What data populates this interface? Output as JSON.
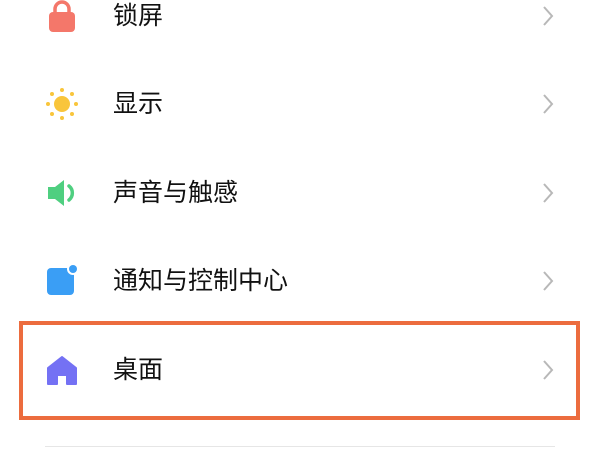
{
  "settings": {
    "items": [
      {
        "label": "锁屏",
        "icon": "lock-icon",
        "icon_color": "#f4776a"
      },
      {
        "label": "显示",
        "icon": "sun-icon",
        "icon_color": "#f9c53b"
      },
      {
        "label": "声音与触感",
        "icon": "speaker-icon",
        "icon_color": "#4fcf80"
      },
      {
        "label": "通知与控制中心",
        "icon": "notification-icon",
        "icon_color": "#3a9ef5"
      },
      {
        "label": "桌面",
        "icon": "home-icon",
        "icon_color": "#7471f4"
      }
    ],
    "highlighted_item": "桌面",
    "highlight_color": "#ec6c3e",
    "chevron_color": "#b8b8b8"
  }
}
